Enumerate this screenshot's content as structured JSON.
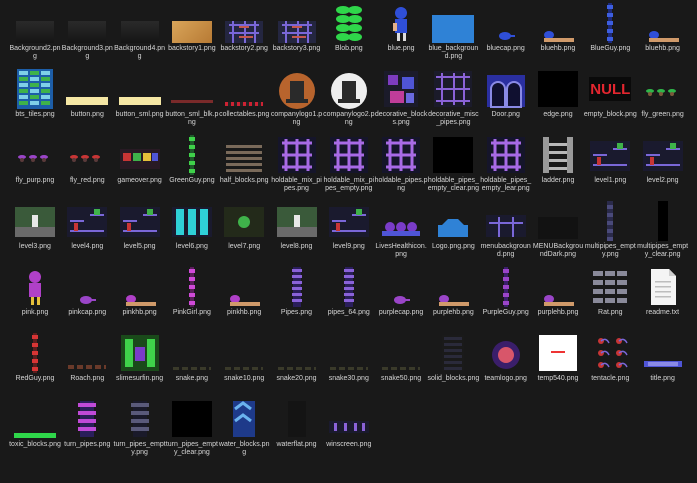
{
  "files": [
    {
      "name": "Background2.png",
      "thumb": "dark"
    },
    {
      "name": "Background3.png",
      "thumb": "dark"
    },
    {
      "name": "Background4.png",
      "thumb": "dark"
    },
    {
      "name": "backstory1.png",
      "thumb": "tan"
    },
    {
      "name": "backstory2.png",
      "thumb": "pipes"
    },
    {
      "name": "backstory3.png",
      "thumb": "pipes"
    },
    {
      "name": "Blob.png",
      "thumb": "blob"
    },
    {
      "name": "blue.png",
      "thumb": "char-blue"
    },
    {
      "name": "blue_background.png",
      "thumb": "bluebox"
    },
    {
      "name": "bluecap.png",
      "thumb": "cap-blue"
    },
    {
      "name": "bluehb.png",
      "thumb": "hb-blue"
    },
    {
      "name": "BlueGuy.png",
      "thumb": "column-blue"
    },
    {
      "name": "bluehb.png",
      "thumb": "hb-blue"
    },
    {
      "name": "bts_tiles.png",
      "thumb": "tiles"
    },
    {
      "name": "button.png",
      "thumb": "button"
    },
    {
      "name": "button_sml.png",
      "thumb": "button"
    },
    {
      "name": "button_sml_blk.png",
      "thumb": "blkline"
    },
    {
      "name": "collectables.png",
      "thumb": "collect"
    },
    {
      "name": "companylogo1.png",
      "thumb": "logo-orange"
    },
    {
      "name": "companylogo2.png",
      "thumb": "logo-white"
    },
    {
      "name": "decorative_blocks.png",
      "thumb": "deco"
    },
    {
      "name": "decorative_misc_pipes.png",
      "thumb": "pipes-grid"
    },
    {
      "name": "Door.png",
      "thumb": "door"
    },
    {
      "name": "edge.png",
      "thumb": "black"
    },
    {
      "name": "empty_block.png",
      "thumb": "null"
    },
    {
      "name": "fly_green.png",
      "thumb": "fly-green"
    },
    {
      "name": "fly_purp.png",
      "thumb": "fly-purp"
    },
    {
      "name": "fly_red.png",
      "thumb": "fly-red"
    },
    {
      "name": "gameover.png",
      "thumb": "gameover"
    },
    {
      "name": "GreenGuy.png",
      "thumb": "column-green"
    },
    {
      "name": "half_blocks.png",
      "thumb": "halfblocks"
    },
    {
      "name": "holdable_mix_pipes.png",
      "thumb": "holdable"
    },
    {
      "name": "holdable_mix_pipes_empty.png",
      "thumb": "holdable"
    },
    {
      "name": "holdable_pipes.png",
      "thumb": "holdable"
    },
    {
      "name": "holdable_pipes_empty_clear.png",
      "thumb": "black"
    },
    {
      "name": "holdable_pipes_empty_lear.png",
      "thumb": "holdable"
    },
    {
      "name": "ladder.png",
      "thumb": "ladder"
    },
    {
      "name": "level1.png",
      "thumb": "level"
    },
    {
      "name": "level2.png",
      "thumb": "level"
    },
    {
      "name": "level3.png",
      "thumb": "level-green"
    },
    {
      "name": "level4.png",
      "thumb": "level"
    },
    {
      "name": "level5.png",
      "thumb": "level"
    },
    {
      "name": "level6.png",
      "thumb": "level-cyan"
    },
    {
      "name": "level7.png",
      "thumb": "level-dark"
    },
    {
      "name": "level8.png",
      "thumb": "level-green"
    },
    {
      "name": "level9.png",
      "thumb": "level"
    },
    {
      "name": "LivesHealthicon.png",
      "thumb": "lives"
    },
    {
      "name": "Logo.png.png",
      "thumb": "logo-small"
    },
    {
      "name": "menubackground.png",
      "thumb": "menubg"
    },
    {
      "name": "MENUBackgroundDark.png",
      "thumb": "menudark"
    },
    {
      "name": "multipipes_empty.png",
      "thumb": "column-dark"
    },
    {
      "name": "multipipes_empty_clear.png",
      "thumb": "column-black"
    },
    {
      "name": "pink.png",
      "thumb": "char-pink"
    },
    {
      "name": "pinkcap.png",
      "thumb": "cap-purple"
    },
    {
      "name": "pinkhb.png",
      "thumb": "hb-pink"
    },
    {
      "name": "PinkGirl.png",
      "thumb": "column-pink"
    },
    {
      "name": "pinkhb.png",
      "thumb": "hb-pink"
    },
    {
      "name": "Pipes.png",
      "thumb": "column-purple"
    },
    {
      "name": "pipes_64.png",
      "thumb": "column-purple"
    },
    {
      "name": "purplecap.png",
      "thumb": "cap-purple"
    },
    {
      "name": "purplehb.png",
      "thumb": "hb-purple"
    },
    {
      "name": "PurpleGuy.png",
      "thumb": "column-purple2"
    },
    {
      "name": "purplehb.png",
      "thumb": "hb-purple"
    },
    {
      "name": "Rat.png",
      "thumb": "rat"
    },
    {
      "name": "readme.txt",
      "thumb": "doc"
    },
    {
      "name": "RedGuy.png",
      "thumb": "column-red"
    },
    {
      "name": "Roach.png",
      "thumb": "roach"
    },
    {
      "name": "slimesurfin.png",
      "thumb": "slime"
    },
    {
      "name": "snake.png",
      "thumb": "snake"
    },
    {
      "name": "snake10.png",
      "thumb": "snake"
    },
    {
      "name": "snake20.png",
      "thumb": "snake"
    },
    {
      "name": "snake30.png",
      "thumb": "snake"
    },
    {
      "name": "snake50.png",
      "thumb": "snake"
    },
    {
      "name": "solid_blocks.png",
      "thumb": "solid"
    },
    {
      "name": "teamlogo.png",
      "thumb": "teamlogo"
    },
    {
      "name": "temp540.png",
      "thumb": "temp"
    },
    {
      "name": "tentacle.png",
      "thumb": "tentacle"
    },
    {
      "name": "title.png",
      "thumb": "title"
    },
    {
      "name": "toxic_blocks.png",
      "thumb": "toxic"
    },
    {
      "name": "turn_pipes.png",
      "thumb": "turn"
    },
    {
      "name": "turn_pipes_empty.png",
      "thumb": "turn-empty"
    },
    {
      "name": "turn_pipes_empty_clear.png",
      "thumb": "black"
    },
    {
      "name": "water_blocks.png",
      "thumb": "water"
    },
    {
      "name": "waterflat.png",
      "thumb": "waterflat"
    },
    {
      "name": "winscreen.png",
      "thumb": "win"
    }
  ],
  "thumb_text": {
    "null": "NULL"
  }
}
